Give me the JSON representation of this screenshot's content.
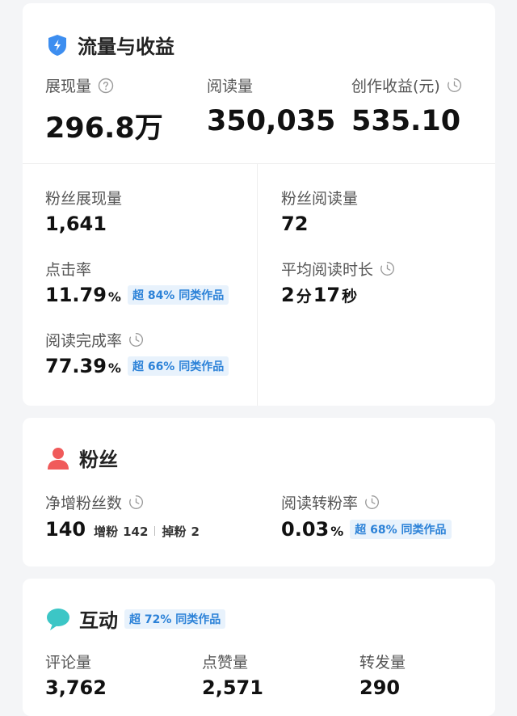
{
  "traffic": {
    "title": "流量与收益",
    "impressions_label": "展现量",
    "impressions_value": "296.8万",
    "reads_label": "阅读量",
    "reads_value": "350,035",
    "earnings_label": "创作收益(元)",
    "earnings_value": "535.10",
    "fan_impressions_label": "粉丝展现量",
    "fan_impressions_value": "1,641",
    "fan_reads_label": "粉丝阅读量",
    "fan_reads_value": "72",
    "ctr_label": "点击率",
    "ctr_value": "11.79",
    "ctr_unit": "%",
    "ctr_badge": "超 84% 同类作品",
    "avg_read_time_label": "平均阅读时长",
    "avg_read_time_min": "2",
    "avg_read_time_min_unit": "分",
    "avg_read_time_sec": "17",
    "avg_read_time_sec_unit": "秒",
    "completion_label": "阅读完成率",
    "completion_value": "77.39",
    "completion_unit": "%",
    "completion_badge": "超 66% 同类作品"
  },
  "fans": {
    "title": "粉丝",
    "net_label": "净增粉丝数",
    "net_value": "140",
    "gain_label": "增粉",
    "gain_value": "142",
    "loss_label": "掉粉",
    "loss_value": "2",
    "conversion_label": "阅读转粉率",
    "conversion_value": "0.03",
    "conversion_unit": "%",
    "conversion_badge": "超 68% 同类作品"
  },
  "interaction": {
    "title": "互动",
    "badge": "超 72% 同类作品",
    "comments_label": "评论量",
    "comments_value": "3,762",
    "likes_label": "点赞量",
    "likes_value": "2,571",
    "shares_label": "转发量",
    "shares_value": "290"
  },
  "icons": {
    "traffic": "lightning-shield-icon",
    "fans": "person-icon",
    "interaction": "speech-bubble-icon",
    "help": "question-circle-icon",
    "history": "clock-history-icon"
  },
  "colors": {
    "accent_blue": "#3d8ef0",
    "badge_bg": "#e8f2fc",
    "badge_text": "#2c82d8",
    "person_red": "#f05a5a",
    "bubble_teal": "#3cc6c6"
  }
}
